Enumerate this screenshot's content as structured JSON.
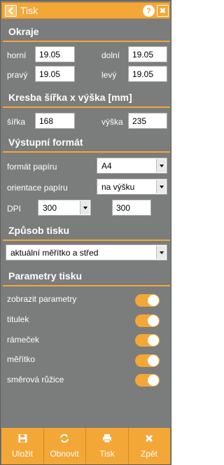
{
  "header": {
    "title": "Tisk",
    "help": "?",
    "close": "✖"
  },
  "margins": {
    "title": "Okraje",
    "top_label": "horní",
    "top_value": "19.05",
    "bottom_label": "dolní",
    "bottom_value": "19.05",
    "right_label": "pravý",
    "right_value": "19.05",
    "left_label": "levý",
    "left_value": "19.05"
  },
  "drawing": {
    "title": "Kresba šířka x výška [mm]",
    "width_label": "šířka",
    "width_value": "168",
    "height_label": "výška",
    "height_value": "235"
  },
  "output": {
    "title": "Výstupní formát",
    "paper_format_label": "formát papíru",
    "paper_format_value": "A4",
    "orientation_label": "orientace papíru",
    "orientation_value": "na výšku",
    "dpi_label": "DPI",
    "dpi_select_value": "300",
    "dpi_input_value": "300"
  },
  "print_mode": {
    "title": "Způsob tisku",
    "value": "aktuální měřítko a střed"
  },
  "params": {
    "title": "Parametry tisku",
    "items": [
      {
        "label": "zobrazit parametry",
        "on": true
      },
      {
        "label": "titulek",
        "on": true
      },
      {
        "label": "rámeček",
        "on": true
      },
      {
        "label": "měřítko",
        "on": true
      },
      {
        "label": "směrová růžice",
        "on": true
      }
    ]
  },
  "footer": {
    "save": "Uložit",
    "refresh": "Obnovit",
    "print": "Tisk",
    "back": "Zpět"
  },
  "colors": {
    "accent": "#f3a737",
    "panel": "#7b7c7c"
  }
}
